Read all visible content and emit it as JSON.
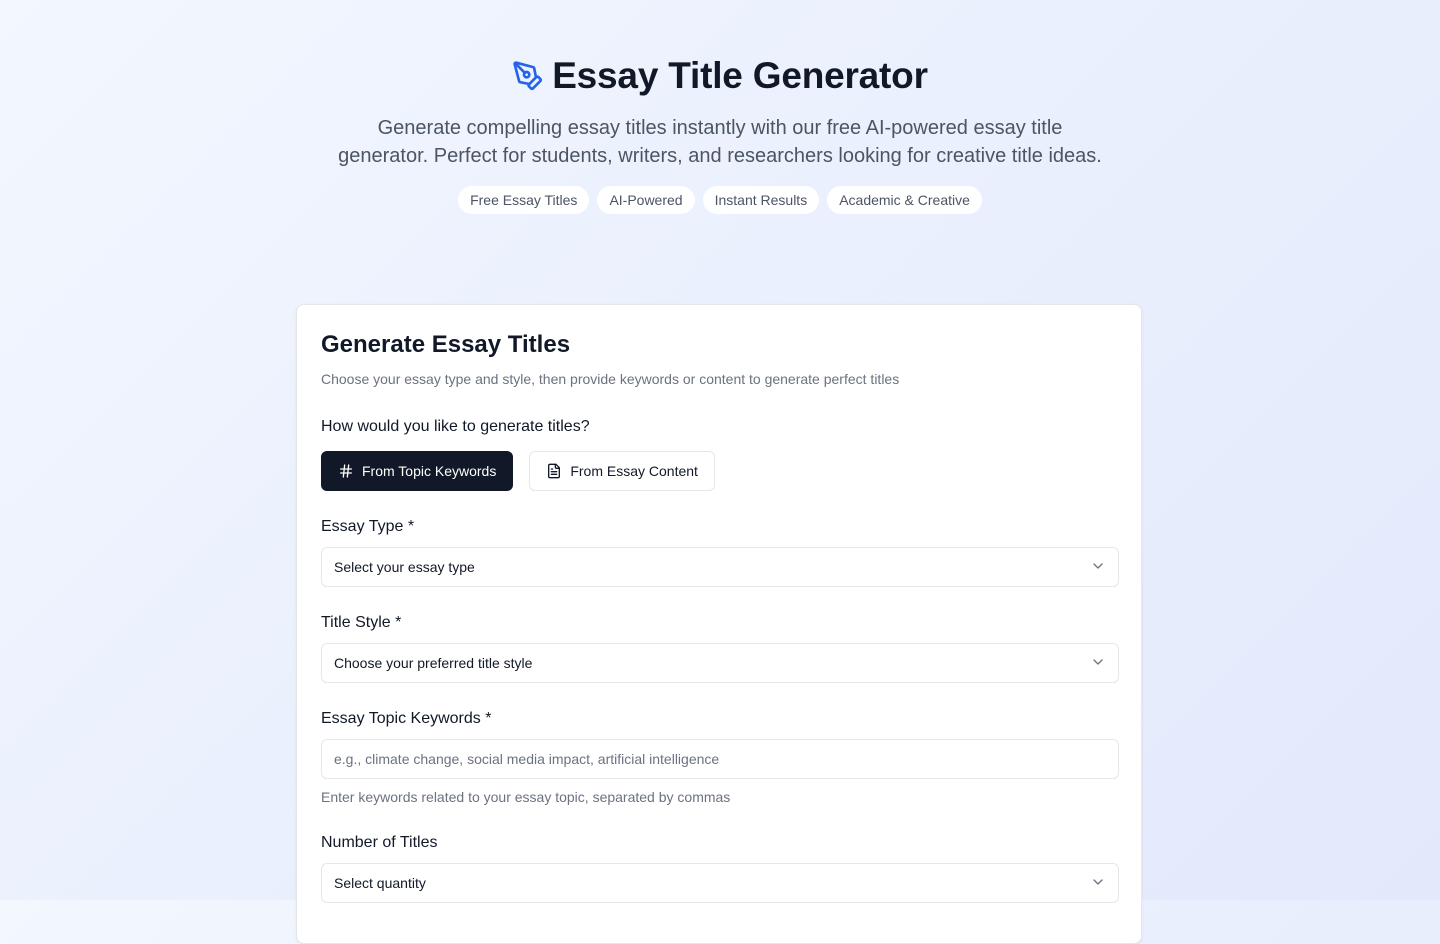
{
  "header": {
    "title": "Essay Title Generator",
    "icon": "pen-tool-icon",
    "subtitle": "Generate compelling essay titles instantly with our free AI-powered essay title generator. Perfect for students, writers, and researchers looking for creative title ideas.",
    "badges": [
      "Free Essay Titles",
      "AI-Powered",
      "Instant Results",
      "Academic & Creative"
    ]
  },
  "card": {
    "title": "Generate Essay Titles",
    "description": "Choose your essay type and style, then provide keywords or content to generate perfect titles",
    "mode_question": "How would you like to generate titles?",
    "modes": [
      {
        "label": "From Topic Keywords",
        "icon": "hash-icon",
        "active": true
      },
      {
        "label": "From Essay Content",
        "icon": "file-text-icon",
        "active": false
      }
    ],
    "essay_type": {
      "label": "Essay Type *",
      "value": "Select your essay type"
    },
    "title_style": {
      "label": "Title Style *",
      "value": "Choose your preferred title style"
    },
    "keywords": {
      "label": "Essay Topic Keywords *",
      "placeholder": "e.g., climate change, social media impact, artificial intelligence",
      "value": "",
      "helper": "Enter keywords related to your essay topic, separated by commas"
    },
    "quantity": {
      "label": "Number of Titles",
      "value": "Select quantity"
    }
  },
  "colors": {
    "accent_icon": "#2563eb",
    "primary_button": "#111827",
    "muted_text": "#6b7280"
  }
}
